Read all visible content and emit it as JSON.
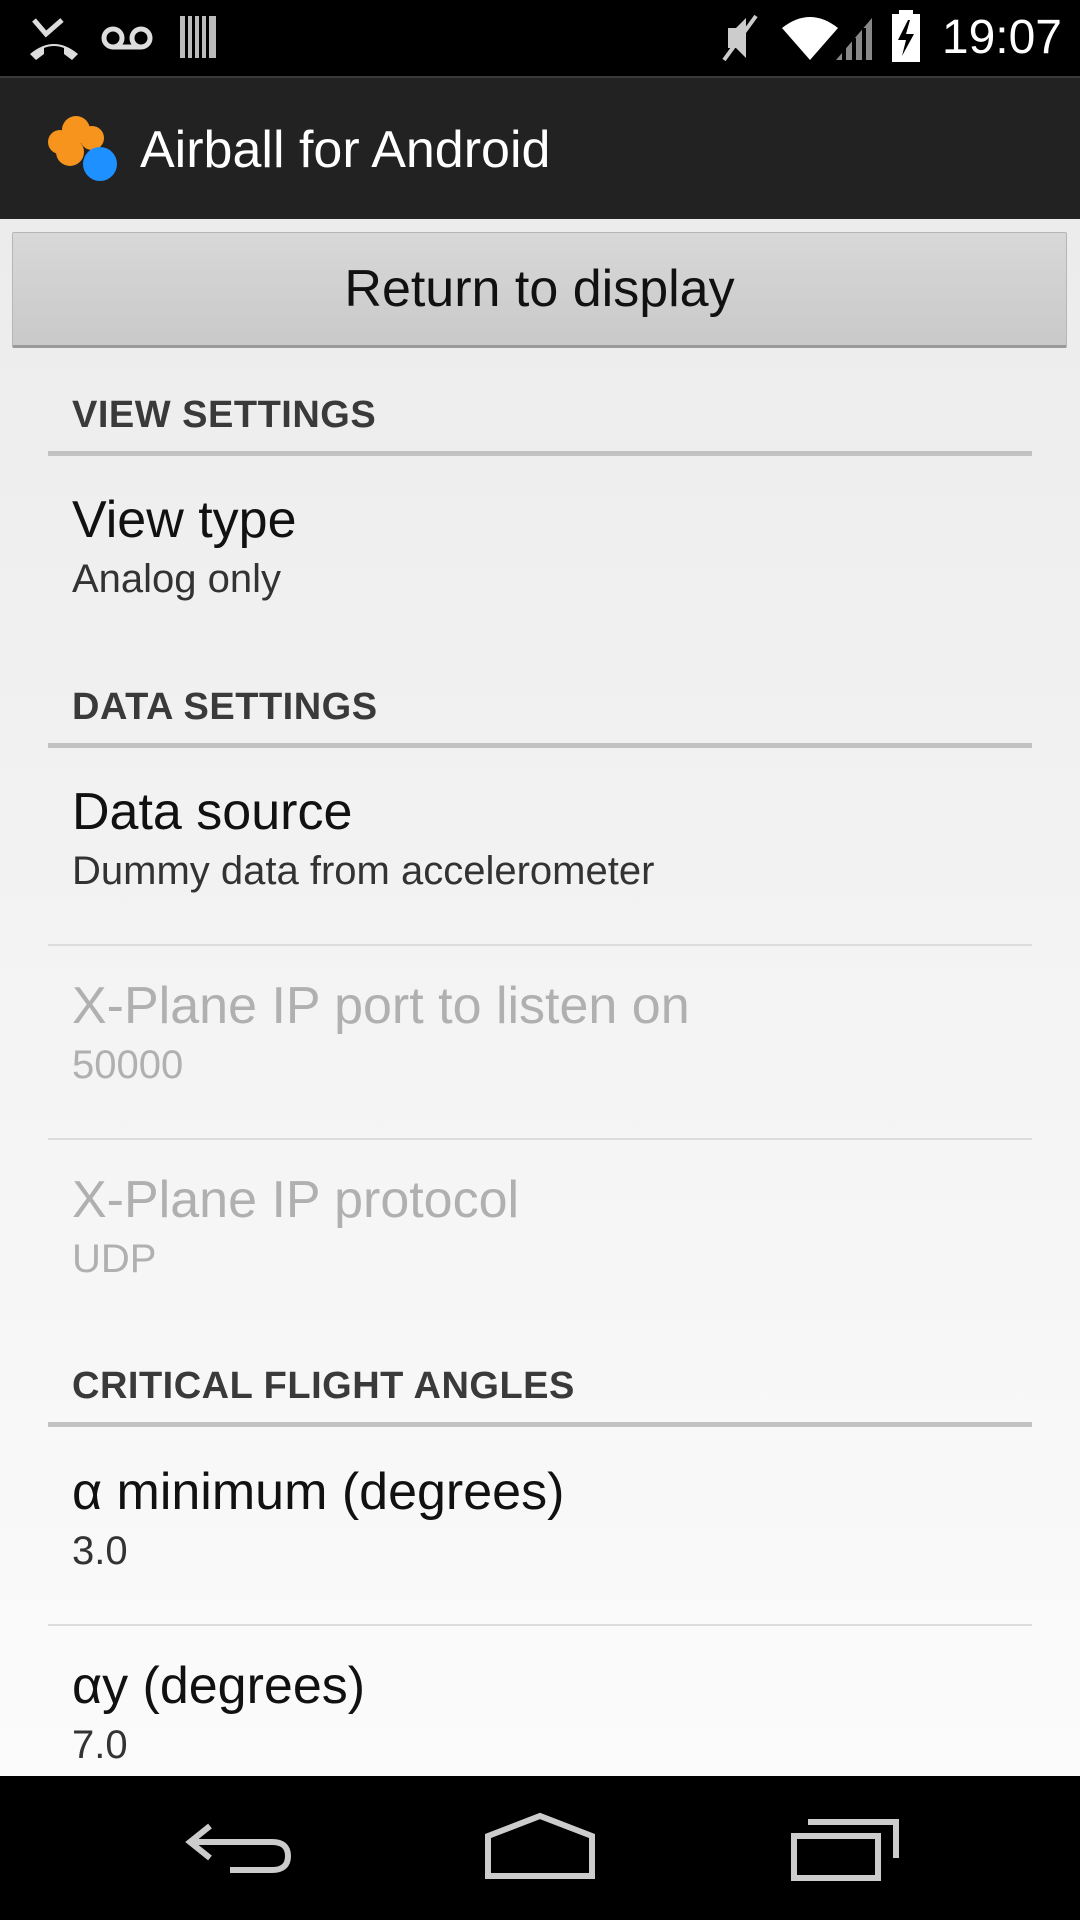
{
  "status_bar": {
    "time": "19:07",
    "icons": [
      "missed-call-icon",
      "voicemail-icon",
      "barcode-icon",
      "mute-icon",
      "wifi-icon",
      "signal-icon",
      "battery-charging-icon"
    ]
  },
  "action_bar": {
    "app_title": "Airball for Android",
    "logo_icon": "cloud-logo-icon",
    "logo_colors": [
      "#f7941d",
      "#1e90ff"
    ]
  },
  "return_button": {
    "label": "Return to display"
  },
  "categories": [
    {
      "title": "VIEW SETTINGS",
      "items": [
        {
          "title": "View type",
          "summary": "Analog only",
          "enabled": true
        }
      ]
    },
    {
      "title": "DATA SETTINGS",
      "items": [
        {
          "title": "Data source",
          "summary": "Dummy data from accelerometer",
          "enabled": true
        },
        {
          "title": "X-Plane IP port to listen on",
          "summary": "50000",
          "enabled": false
        },
        {
          "title": "X-Plane IP protocol",
          "summary": "UDP",
          "enabled": false
        }
      ]
    },
    {
      "title": "CRITICAL FLIGHT ANGLES",
      "items": [
        {
          "title": "α minimum (degrees)",
          "summary": "3.0",
          "enabled": true
        },
        {
          "title": "αy (degrees)",
          "summary": "7.0",
          "enabled": true
        }
      ]
    }
  ],
  "nav_bar": {
    "buttons": [
      "back-icon",
      "home-icon",
      "recent-apps-icon"
    ]
  }
}
